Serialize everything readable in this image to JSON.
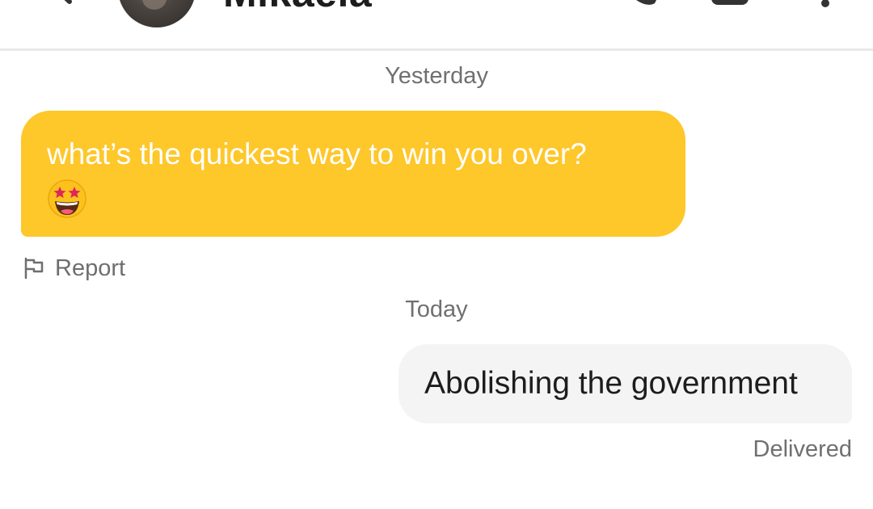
{
  "header": {
    "contact_name": "Mikaela",
    "back_icon": "chevron-left-icon",
    "call_icon": "phone-icon",
    "video_icon": "video-camera-icon",
    "more_icon": "more-vertical-icon"
  },
  "conversation": {
    "day_separators": [
      "Yesterday",
      "Today"
    ],
    "messages": [
      {
        "direction": "incoming",
        "text": "what’s the quickest way to win you over?",
        "emoji": "star-struck-emoji",
        "bubble_color": "#fec72a"
      },
      {
        "direction": "outgoing",
        "text": "Abolishing the government",
        "status": "Delivered",
        "bubble_color": "#f4f4f4"
      }
    ],
    "report_label": "Report",
    "report_icon": "flag-icon"
  },
  "colors": {
    "accent": "#fec72a",
    "muted_text": "#707070",
    "divider": "#e9e9e9"
  }
}
